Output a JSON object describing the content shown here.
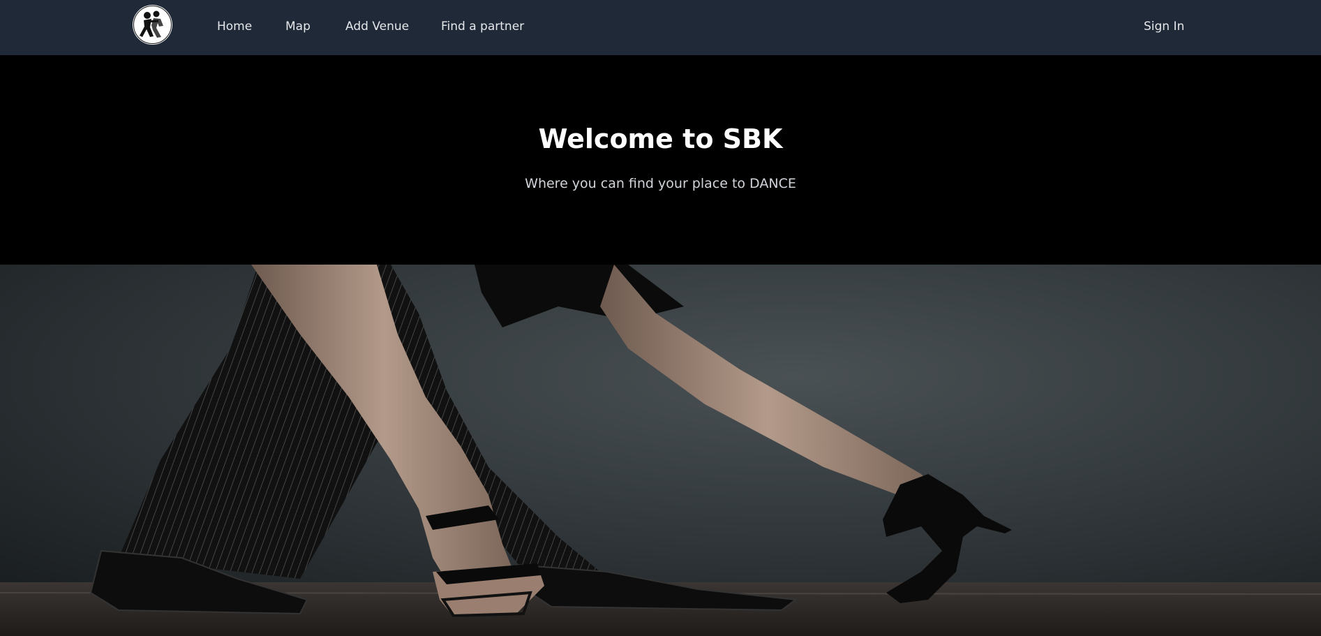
{
  "nav": {
    "logo_icon": "dancing-couple-logo",
    "links": [
      {
        "label": "Home"
      },
      {
        "label": "Map"
      },
      {
        "label": "Add Venue"
      },
      {
        "label": "Find a partner"
      }
    ],
    "signin_label": "Sign In"
  },
  "hero": {
    "title": "Welcome to SBK",
    "subtitle": "Where you can find your place to DANCE"
  },
  "colors": {
    "navbar_bg": "#1f2937",
    "hero_bg": "#000000",
    "nav_text": "#e5e7eb"
  }
}
